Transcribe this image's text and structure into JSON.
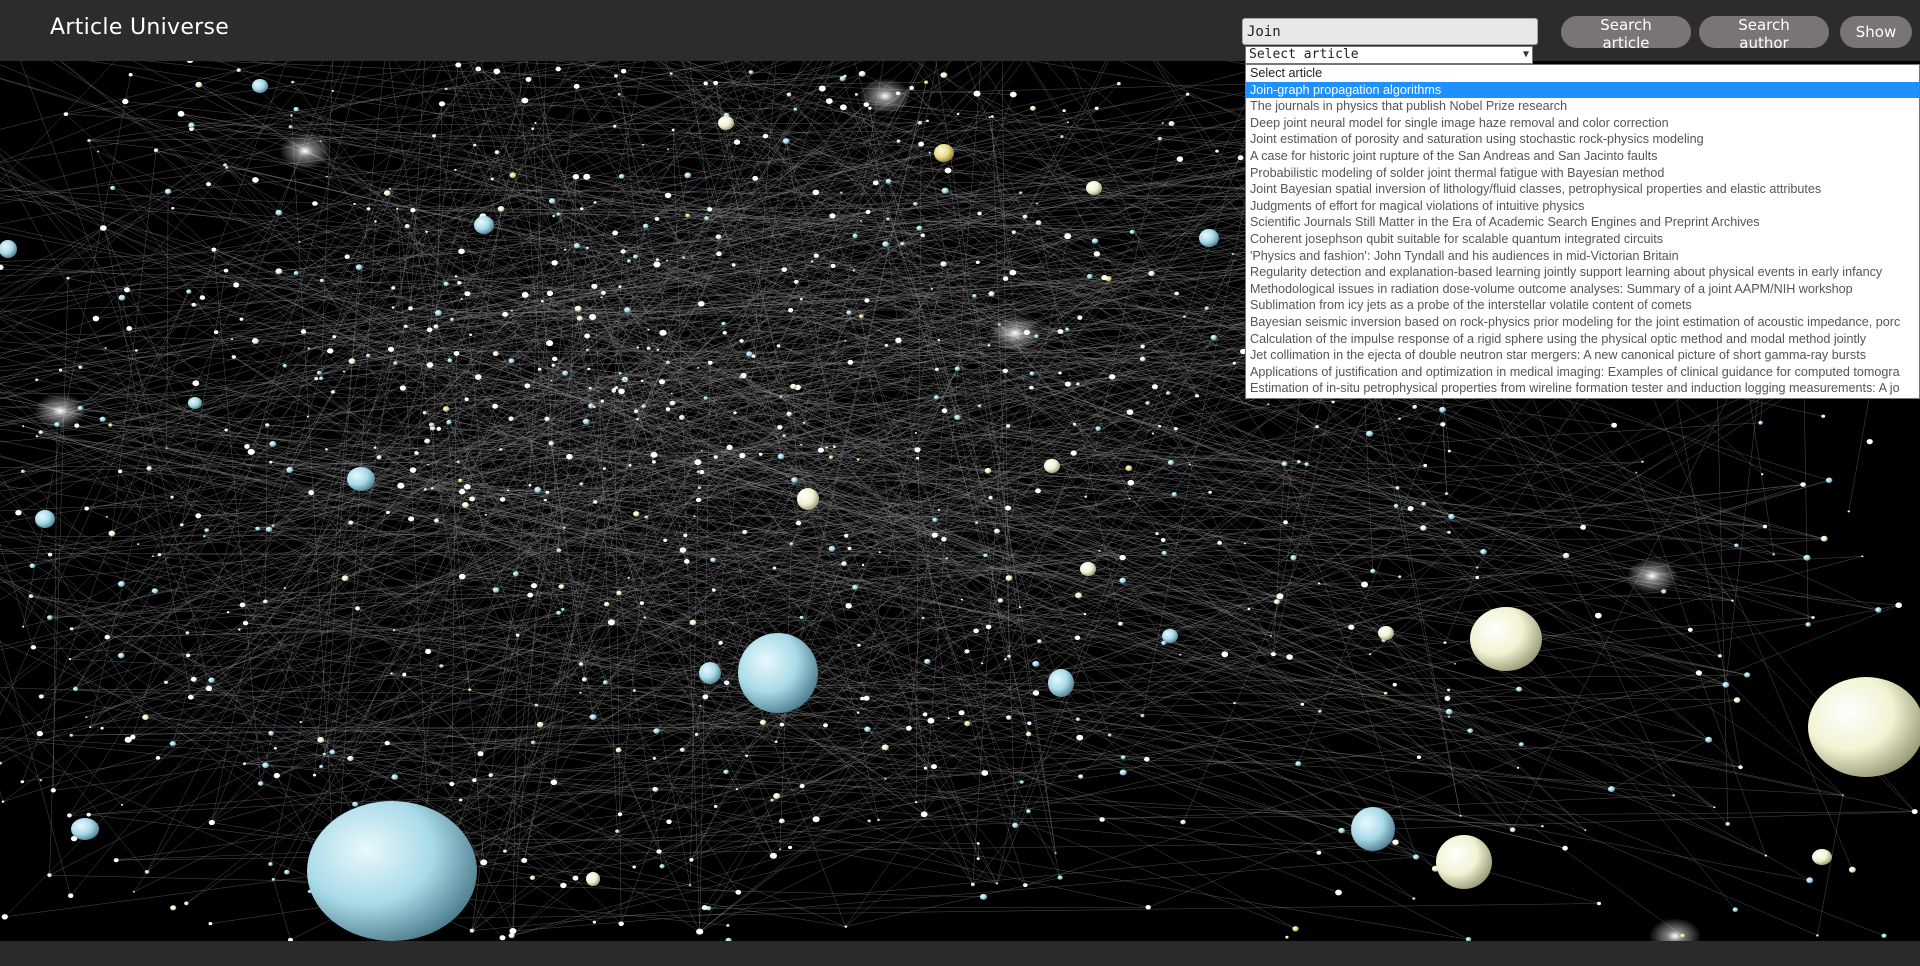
{
  "header": {
    "title": "Article Universe",
    "search": {
      "value": "Join"
    },
    "buttons": {
      "search_article": "Search article",
      "search_author": "Search author",
      "show": "Show"
    }
  },
  "article_select": {
    "selected": "Select article",
    "options": [
      "Select article",
      "Join-graph propagation algorithms",
      "The journals in physics that publish Nobel Prize research",
      "Deep joint neural model for single image haze removal and color correction",
      "Joint estimation of porosity and saturation using stochastic rock-physics modeling",
      "A case for historic joint rupture of the San Andreas and San Jacinto faults",
      "Probabilistic modeling of solder joint thermal fatigue with Bayesian method",
      "Joint Bayesian spatial inversion of lithology/fluid classes, petrophysical properties and elastic attributes",
      "Judgments of effort for magical violations of intuitive physics",
      "Scientific Journals Still Matter in the Era of Academic Search Engines and Preprint Archives",
      "Coherent josephson qubit suitable for scalable quantum integrated circuits",
      "'Physics and fashion': John Tyndall and his audiences in mid-Victorian Britain",
      "Regularity detection and explanation-based learning jointly support learning about physical events in early infancy",
      "Methodological issues in radiation dose-volume outcome analyses: Summary of a joint AAPM/NIH workshop",
      "Sublimation from icy jets as a probe of the interstellar volatile content of comets",
      "Bayesian seismic inversion based on rock-physics prior modeling for the joint estimation of acoustic impedance, porc",
      "Calculation of the impulse response of a rigid sphere using the physical optic method and modal method jointly",
      "Jet collimation in the ejecta of double neutron star mergers: A new canonical picture of short gamma-ray bursts",
      "Applications of justification and optimization in medical imaging: Examples of clinical guidance for computed tomogra",
      "Estimation of in-situ petrophysical properties from wireline formation tester and induction logging measurements: A jo"
    ],
    "highlighted_index": 1
  },
  "colors": {
    "background": "#000000",
    "highlight": "#1e90ff",
    "button": "#7a7474",
    "node_blue": "#a9dbe8",
    "node_cream": "#f2f3d2",
    "node_yellow": "#e8d98a",
    "edge": "#8a8a8a"
  },
  "icons": {
    "select_arrow": "chevron-down-icon"
  }
}
